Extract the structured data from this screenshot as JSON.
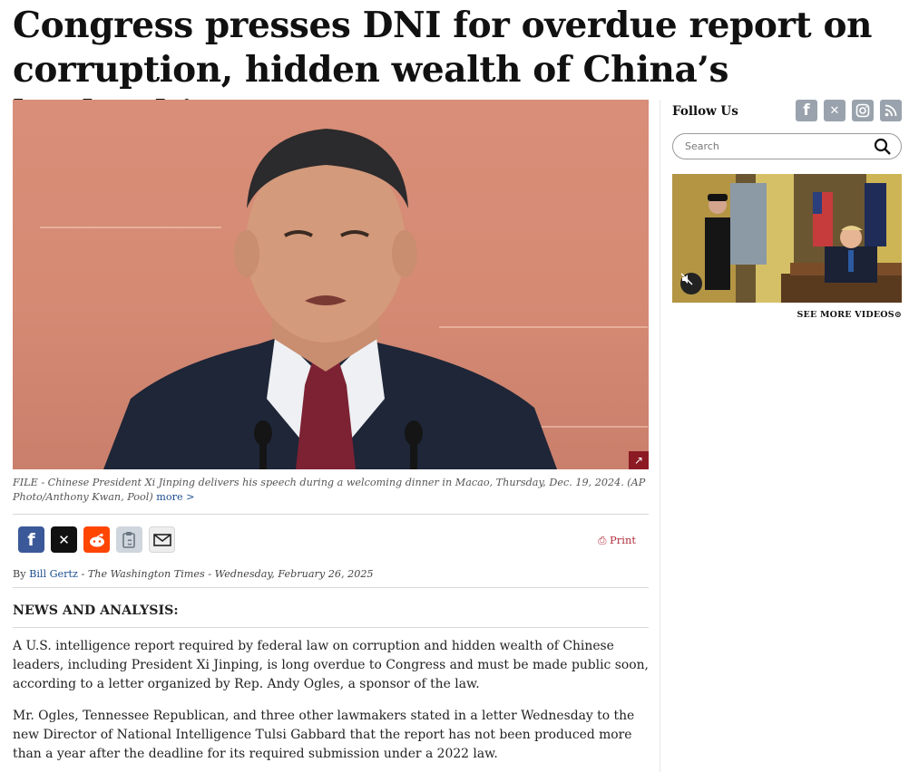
{
  "article": {
    "headline": "Congress presses DNI for overdue report on corruption, hidden wealth of China’s leadership",
    "image_caption": "FILE - Chinese President Xi Jinping delivers his speech during a welcoming dinner in Macao, Thursday, Dec. 19, 2024. (AP Photo/Anthony Kwan, Pool)",
    "caption_more": "more >",
    "print_label": "Print",
    "byline_prefix": "By",
    "author": "Bill Gertz",
    "byline_rest": " - The Washington Times - Wednesday, February 26, 2025",
    "kicker": "NEWS AND ANALYSIS:",
    "paragraphs": [
      "A U.S. intelligence report required by federal law on corruption and hidden wealth of Chinese leaders, including President Xi Jinping, is long overdue to Congress and must be made public soon, according to a letter organized by Rep. Andy Ogles, a sponsor of the law.",
      "Mr. Ogles, Tennessee Republican, and three other lawmakers stated in a letter Wednesday to the new Director of National Intelligence Tulsi Gabbard that the report has not been produced more than a year after the deadline for its required submission under a 2022 law."
    ]
  },
  "share": {
    "icons": [
      "facebook-icon",
      "x-icon",
      "reddit-icon",
      "copy-link-icon",
      "email-icon"
    ],
    "colors": {
      "facebook": "#3b5998",
      "x": "#111111",
      "reddit": "#ff4500",
      "copy": "#cfd6dd",
      "email": "#eeeeee"
    }
  },
  "sidebar": {
    "follow_label": "Follow Us",
    "social_icons": [
      "facebook-icon",
      "x-icon",
      "instagram-icon",
      "rss-icon"
    ],
    "search_placeholder": "Search",
    "see_more_videos": "SEE MORE VIDEOS"
  },
  "colors": {
    "accent_red": "#8b1a24",
    "link_blue": "#1d4f8f",
    "print_red": "#b23040"
  }
}
